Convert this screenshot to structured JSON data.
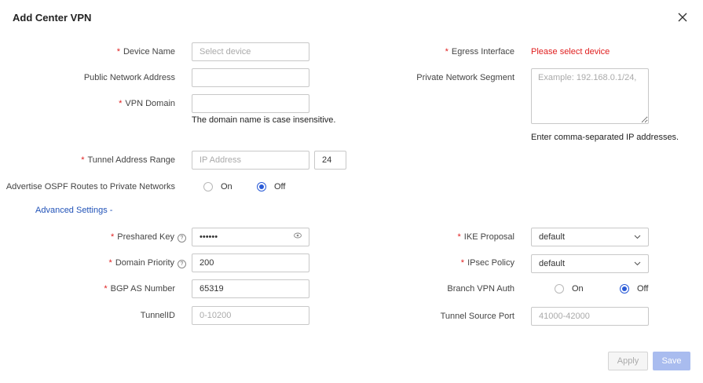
{
  "dialog": {
    "title": "Add Center VPN",
    "close_icon": "close-icon",
    "advanced_label": "Advanced Settings -"
  },
  "fields": {
    "device_name": {
      "label": "Device Name",
      "placeholder": "Select device",
      "required": true
    },
    "public_network_address": {
      "label": "Public Network Address",
      "value": ""
    },
    "vpn_domain": {
      "label": "VPN Domain",
      "value": "",
      "hint": "The domain name is case insensitive.",
      "required": true
    },
    "tunnel_address_range": {
      "label": "Tunnel Address Range",
      "placeholder": "IP Address",
      "mask": "24",
      "required": true
    },
    "advertise_ospf": {
      "label": "Advertise OSPF Routes to Private Networks",
      "on_label": "On",
      "off_label": "Off",
      "selected": "Off"
    },
    "egress_interface": {
      "label": "Egress Interface",
      "error": "Please select device",
      "required": true
    },
    "private_network_segment": {
      "label": "Private Network Segment",
      "placeholder": "Example: 192.168.0.1/24,",
      "hint": "Enter comma-separated IP addresses."
    },
    "preshared_key": {
      "label": "Preshared Key",
      "value": "••••••",
      "required": true
    },
    "domain_priority": {
      "label": "Domain Priority",
      "value": "200",
      "required": true
    },
    "bgp_as_number": {
      "label": "BGP AS Number",
      "value": "65319",
      "required": true
    },
    "tunnel_id": {
      "label": "TunnelID",
      "placeholder": "0-10200"
    },
    "ike_proposal": {
      "label": "IKE Proposal",
      "value": "default",
      "required": true
    },
    "ipsec_policy": {
      "label": "IPsec Policy",
      "value": "default",
      "required": true
    },
    "branch_vpn_auth": {
      "label": "Branch VPN Auth",
      "on_label": "On",
      "off_label": "Off",
      "selected": "Off"
    },
    "tunnel_source_port": {
      "label": "Tunnel Source Port",
      "placeholder": "41000-42000"
    }
  },
  "footer": {
    "apply_label": "Apply",
    "save_label": "Save"
  },
  "colors": {
    "required": "#e02020",
    "link": "#2253b8",
    "radio_active": "#2a5bd7",
    "save_disabled": "#a9bcef"
  }
}
